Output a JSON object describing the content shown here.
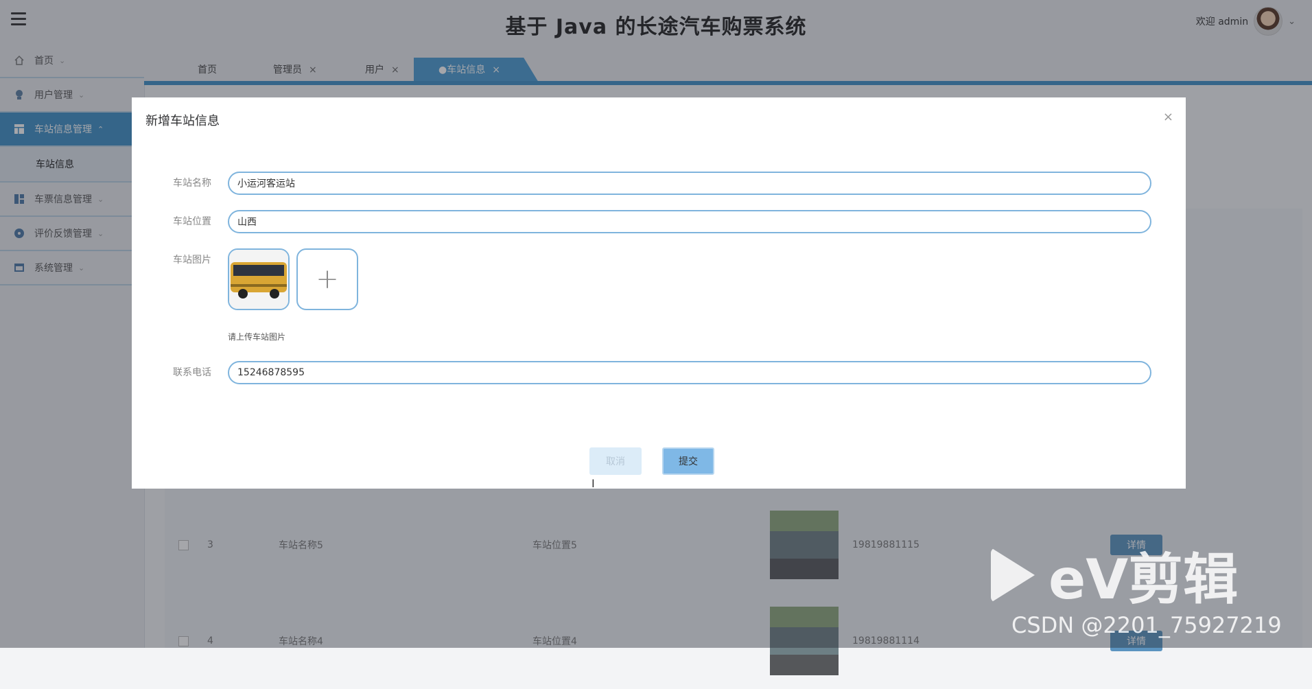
{
  "app": {
    "title": "基于 Java 的长途汽车购票系统",
    "welcome": "欢迎 admin"
  },
  "sidebar": {
    "items": [
      {
        "label": "首页",
        "icon": "home-icon"
      },
      {
        "label": "用户管理",
        "icon": "user-icon"
      },
      {
        "label": "车站信息管理",
        "icon": "table-icon",
        "active": true
      },
      {
        "label": "车票信息管理",
        "icon": "grid-icon"
      },
      {
        "label": "评价反馈管理",
        "icon": "circle-icon"
      },
      {
        "label": "系统管理",
        "icon": "window-icon"
      }
    ],
    "sub_item": "车站信息"
  },
  "tabs": [
    {
      "label": "首页"
    },
    {
      "label": "管理员",
      "close": "×"
    },
    {
      "label": "用户",
      "close": "×"
    },
    {
      "label": "●车站信息",
      "close": "×",
      "active": true
    }
  ],
  "table_rows": [
    {
      "no": "3",
      "name": "车站名称5",
      "position": "车站位置5",
      "phone": "19819881115",
      "action": "详情"
    },
    {
      "no": "4",
      "name": "车站名称4",
      "position": "车站位置4",
      "phone": "19819881114",
      "action": "详情"
    }
  ],
  "dialog": {
    "title": "新增车站信息",
    "close": "×",
    "station_name_label": "车站名称",
    "station_name_value": "小运河客运站",
    "station_location_label": "车站位置",
    "station_location_value": "山西",
    "station_image_label": "车站图片",
    "upload_hint": "请上传车站图片",
    "phone_label": "联系电话",
    "phone_value": "15246878595",
    "cancel_label": "取消",
    "submit_label": "提交"
  },
  "watermark": {
    "brand": "eV剪辑",
    "csdn": "CSDN @2201_75927219"
  },
  "colors": {
    "accent": "#3f8fc7",
    "input_border": "#7fb4dd",
    "submit_bg": "#7fb8e6",
    "cancel_bg": "#dcecf8"
  }
}
